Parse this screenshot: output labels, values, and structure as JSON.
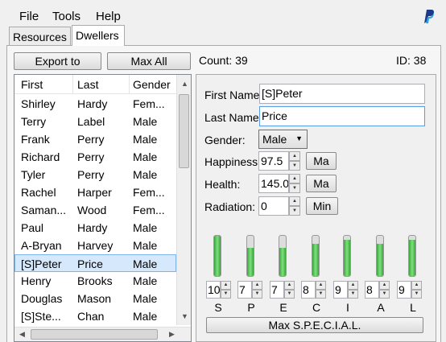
{
  "menu": {
    "file": "File",
    "tools": "Tools",
    "help": "Help"
  },
  "tabs": [
    {
      "label": "Resources"
    },
    {
      "label": "Dwellers"
    }
  ],
  "toolbar": {
    "export_label": "Export to",
    "max_all_label": "Max All"
  },
  "status": {
    "count_text": "Count: 39",
    "id_text": "ID: 38"
  },
  "table": {
    "columns": [
      "First",
      "Last",
      "Gender"
    ],
    "rows": [
      [
        "Shirley",
        "Hardy",
        "Fem..."
      ],
      [
        "Terry",
        "Label",
        "Male"
      ],
      [
        "Frank",
        "Perry",
        "Male"
      ],
      [
        "Richard",
        "Perry",
        "Male"
      ],
      [
        "Tyler",
        "Perry",
        "Male"
      ],
      [
        "Rachel",
        "Harper",
        "Fem..."
      ],
      [
        "Saman...",
        "Wood",
        "Fem..."
      ],
      [
        "Paul",
        "Hardy",
        "Male"
      ],
      [
        "A-Bryan",
        "Harvey",
        "Male"
      ],
      [
        "[S]Peter",
        "Price",
        "Male"
      ],
      [
        "Henry",
        "Brooks",
        "Male"
      ],
      [
        "Douglas",
        "Mason",
        "Male"
      ],
      [
        "[S]Ste...",
        "Chan",
        "Male"
      ]
    ],
    "selected_index": 9
  },
  "detail": {
    "first_name_label": "First Name",
    "first_name_value": "[S]Peter",
    "last_name_label": "Last Name",
    "last_name_value": "Price",
    "gender_label": "Gender:",
    "gender_value": "Male",
    "happiness_label": "Happiness",
    "happiness_value": "97.5",
    "happiness_button": "Ma",
    "health_label": "Health:",
    "health_value": "145.0",
    "health_button": "Ma",
    "radiation_label": "Radiation:",
    "radiation_value": "0",
    "radiation_button": "Min",
    "max_special_label": "Max S.P.E.C.I.A.L."
  },
  "special": [
    {
      "letter": "S",
      "value": "10",
      "level": 1.0
    },
    {
      "letter": "P",
      "value": "7",
      "level": 0.7
    },
    {
      "letter": "E",
      "value": "7",
      "level": 0.7
    },
    {
      "letter": "C",
      "value": "8",
      "level": 0.8
    },
    {
      "letter": "I",
      "value": "9",
      "level": 0.9
    },
    {
      "letter": "A",
      "value": "8",
      "level": 0.8
    },
    {
      "letter": "L",
      "value": "9",
      "level": 0.9
    }
  ],
  "colors": {
    "selection": "#d6e8fb",
    "bar_fill": "#3aa63a"
  }
}
